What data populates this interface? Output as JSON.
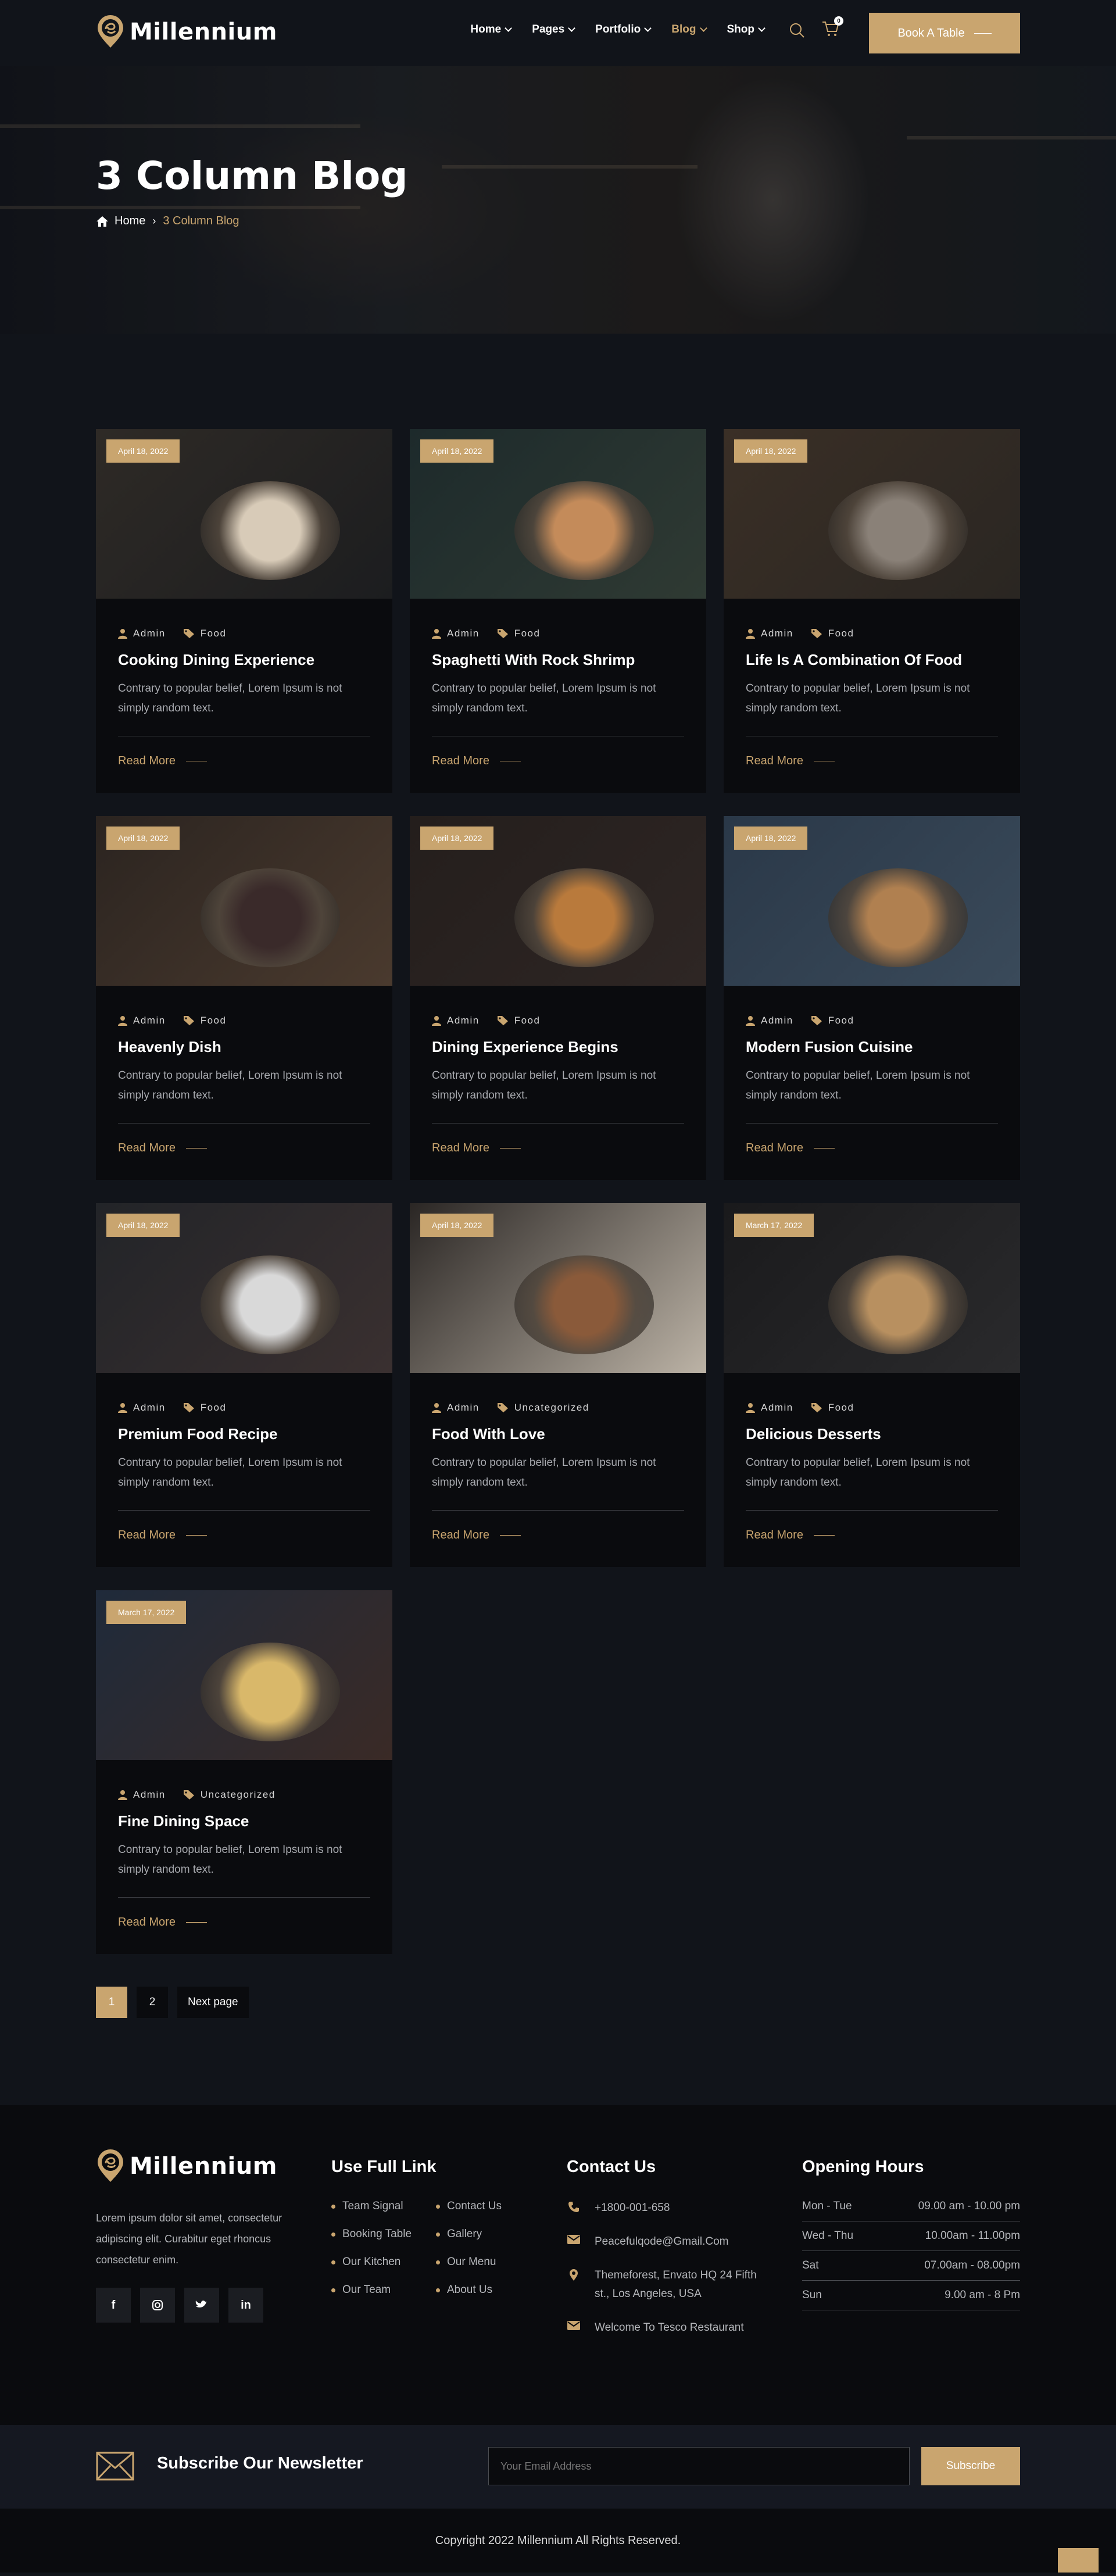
{
  "brand": {
    "name": "Millennium",
    "accent": "#c9a56f"
  },
  "nav": {
    "items": [
      {
        "label": "Home",
        "active": false
      },
      {
        "label": "Pages",
        "active": false
      },
      {
        "label": "Portfolio",
        "active": false
      },
      {
        "label": "Blog",
        "active": true
      },
      {
        "label": "Shop",
        "active": false
      }
    ],
    "cart_count": "0",
    "book_label": "Book A Table"
  },
  "hero": {
    "title": "3 Column Blog",
    "breadcrumb_home": "Home",
    "breadcrumb_current": "3 Column Blog"
  },
  "posts": [
    {
      "date": "April 18, 2022",
      "author": "Admin",
      "category": "Food",
      "title": "Cooking Dining Experience",
      "excerpt": "Contrary to popular belief, Lorem Ipsum is not simply random text.",
      "read_more": "Read More"
    },
    {
      "date": "April 18, 2022",
      "author": "Admin",
      "category": "Food",
      "title": "Spaghetti With Rock Shrimp",
      "excerpt": "Contrary to popular belief, Lorem Ipsum is not simply random text.",
      "read_more": "Read More"
    },
    {
      "date": "April 18, 2022",
      "author": "Admin",
      "category": "Food",
      "title": "Life Is A Combination Of Food",
      "excerpt": "Contrary to popular belief, Lorem Ipsum is not simply random text.",
      "read_more": "Read More"
    },
    {
      "date": "April 18, 2022",
      "author": "Admin",
      "category": "Food",
      "title": "Heavenly Dish",
      "excerpt": "Contrary to popular belief, Lorem Ipsum is not simply random text.",
      "read_more": "Read More"
    },
    {
      "date": "April 18, 2022",
      "author": "Admin",
      "category": "Food",
      "title": "Dining Experience Begins",
      "excerpt": "Contrary to popular belief, Lorem Ipsum is not simply random text.",
      "read_more": "Read More"
    },
    {
      "date": "April 18, 2022",
      "author": "Admin",
      "category": "Food",
      "title": "Modern Fusion Cuisine",
      "excerpt": "Contrary to popular belief, Lorem Ipsum is not simply random text.",
      "read_more": "Read More"
    },
    {
      "date": "April 18, 2022",
      "author": "Admin",
      "category": "Food",
      "title": "Premium Food Recipe",
      "excerpt": "Contrary to popular belief, Lorem Ipsum is not simply random text.",
      "read_more": "Read More"
    },
    {
      "date": "April 18, 2022",
      "author": "Admin",
      "category": "Uncategorized",
      "title": "Food With Love",
      "excerpt": "Contrary to popular belief, Lorem Ipsum is not simply random text.",
      "read_more": "Read More"
    },
    {
      "date": "March 17, 2022",
      "author": "Admin",
      "category": "Food",
      "title": "Delicious Desserts",
      "excerpt": "Contrary to popular belief, Lorem Ipsum is not simply random text.",
      "read_more": "Read More"
    },
    {
      "date": "March 17, 2022",
      "author": "Admin",
      "category": "Uncategorized",
      "title": "Fine Dining Space",
      "excerpt": "Contrary to popular belief, Lorem Ipsum is not simply random text.",
      "read_more": "Read More"
    }
  ],
  "pagination": {
    "pages": [
      "1",
      "2"
    ],
    "current": "1",
    "next_label": "Next page"
  },
  "footer": {
    "description": "Lorem ipsum dolor sit amet, consectetur adipiscing elit. Curabitur eget rhoncus consectetur enim.",
    "links_title": "Use Full Link",
    "links": [
      "Team Signal",
      "Contact Us",
      "Booking Table",
      "Gallery",
      "Our Kitchen",
      "Our Menu",
      "Our Team",
      "About Us"
    ],
    "contact_title": "Contact Us",
    "phone": "+1800-001-658",
    "email": "Peacefulqode@Gmail.Com",
    "address": "Themeforest, Envato HQ 24 Fifth st., Los Angeles, USA",
    "welcome": "Welcome To Tesco Restaurant",
    "hours_title": "Opening Hours",
    "hours": [
      {
        "day": "Mon - Tue",
        "time": "09.00 am - 10.00 pm"
      },
      {
        "day": "Wed - Thu",
        "time": "10.00am - 11.00pm"
      },
      {
        "day": "Sat",
        "time": "07.00am - 08.00pm"
      },
      {
        "day": "Sun",
        "time": "9.00 am - 8 Pm"
      }
    ]
  },
  "newsletter": {
    "title": "Subscribe Our Newsletter",
    "placeholder": "Your Email Address",
    "button": "Subscribe"
  },
  "copyright": "Copyright 2022 Millennium All Rights Reserved."
}
